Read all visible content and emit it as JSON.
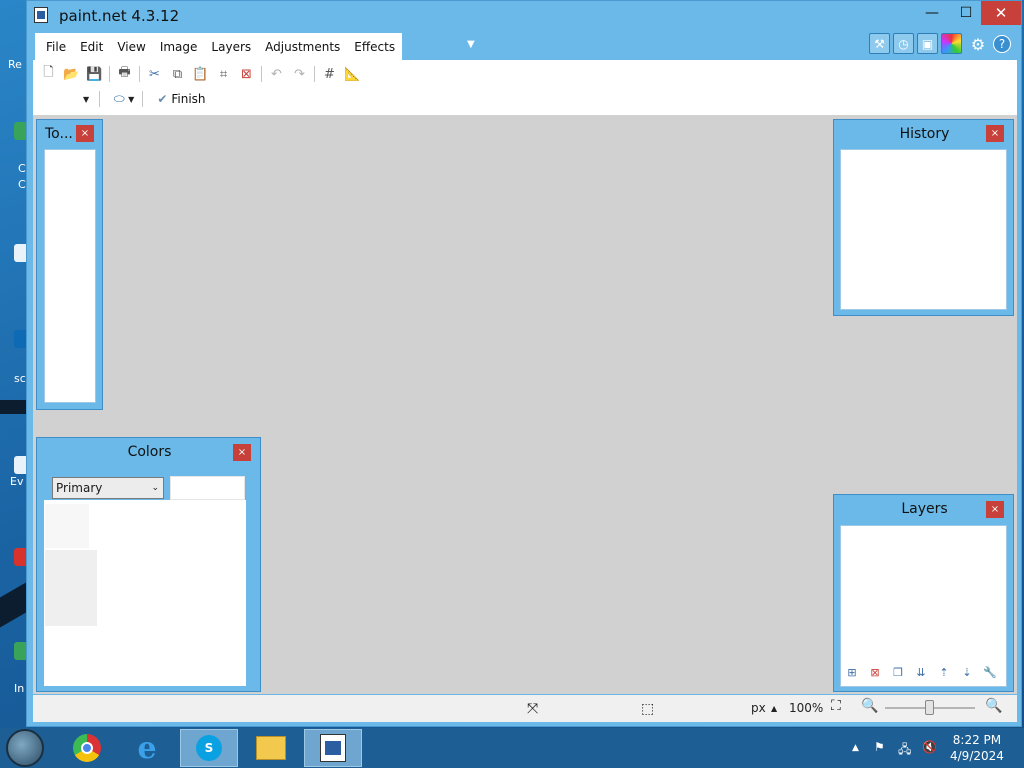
{
  "window": {
    "title": "paint.net 4.3.12",
    "min_glyph": "—",
    "max_glyph": "☐",
    "close_glyph": "✕"
  },
  "menu": [
    "File",
    "Edit",
    "View",
    "Image",
    "Layers",
    "Adjustments",
    "Effects"
  ],
  "toolbar": {
    "finish_label": "Finish"
  },
  "panels": {
    "tools": {
      "title": "To..."
    },
    "history": {
      "title": "History"
    },
    "colors": {
      "title": "Colors",
      "selected_option": "Primary"
    },
    "layers": {
      "title": "Layers"
    }
  },
  "statusbar": {
    "units": "px",
    "zoom": "100%"
  },
  "desktop": {
    "labels": [
      "Re",
      "C",
      "C",
      "sc",
      "Ev",
      "In"
    ]
  },
  "taskbar": {
    "apps": [
      "chrome-icon",
      "internet-explorer-icon",
      "skype-icon",
      "file-explorer-icon",
      "paint-net-icon"
    ],
    "time": "8:22 PM",
    "date": "4/9/2024"
  },
  "colors_accent": {
    "window_frame": "#6ab9e8",
    "close_red": "#c7403a",
    "workspace": "#d1d1d1",
    "taskbar": "#1d5f95"
  }
}
